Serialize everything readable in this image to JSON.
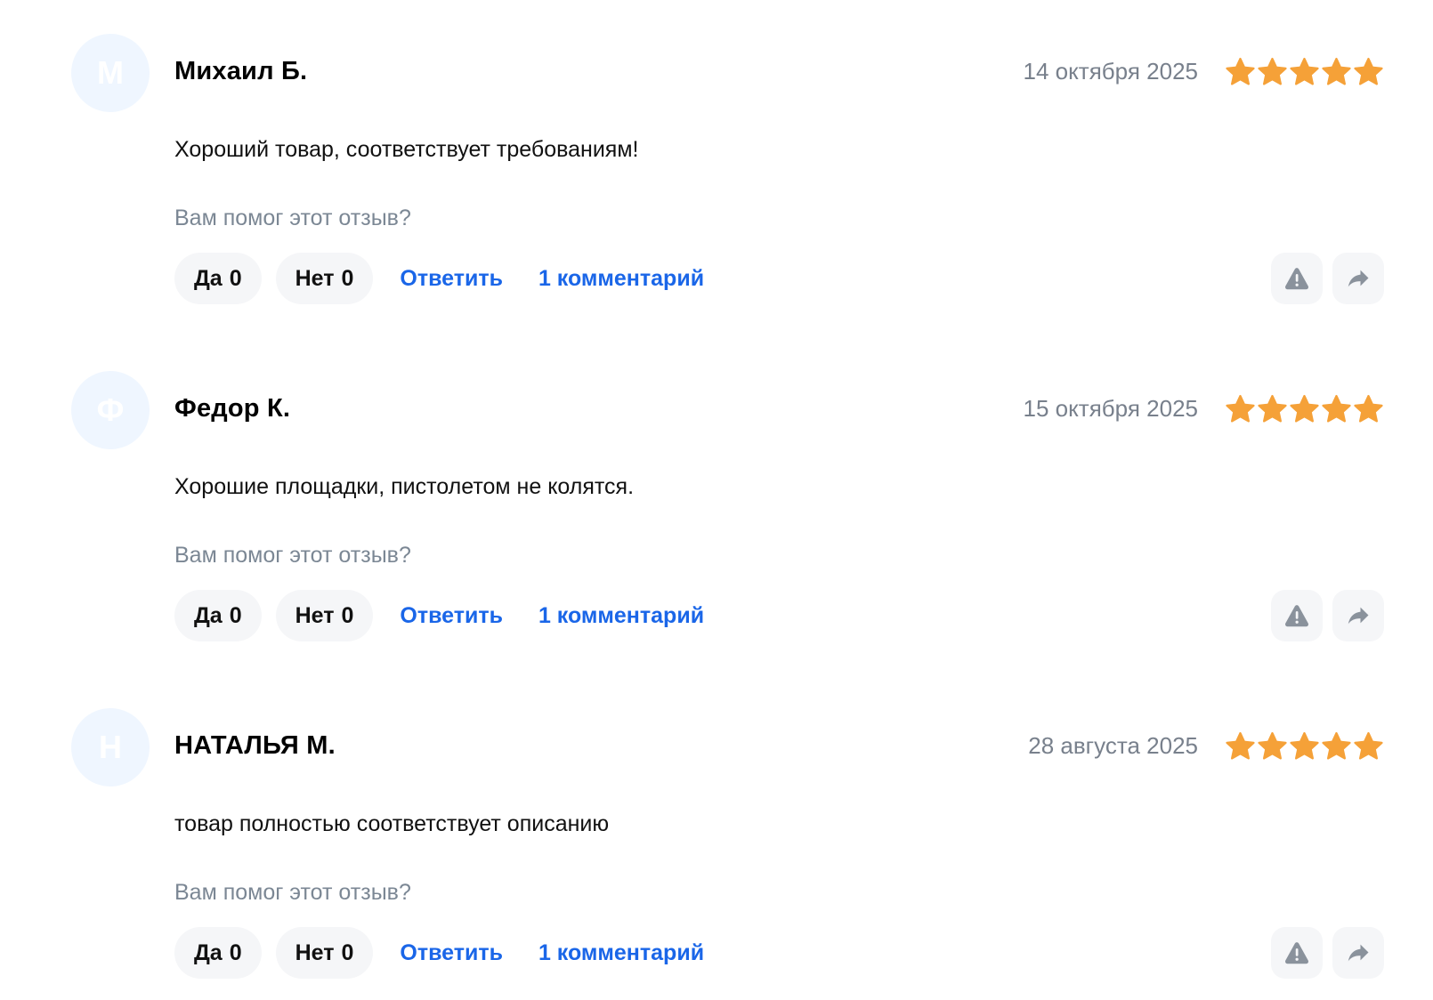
{
  "colors": {
    "star": "#f5a138",
    "link": "#1a66e8",
    "muted": "#7b8794",
    "avatar_bg": "#eff6ff",
    "button_bg": "#f5f6f8"
  },
  "icons": {
    "report": "warning-triangle-icon",
    "share": "share-arrow-icon",
    "star": "star-icon"
  },
  "reviews": [
    {
      "initial": "М",
      "author": "Михаил Б.",
      "date": "14 октября 2025",
      "rating": 5,
      "text": "Хороший товар, соответствует требованиям!",
      "helpful_question": "Вам помог этот отзыв?",
      "yes_label": "Да",
      "yes_count": "0",
      "no_label": "Нет",
      "no_count": "0",
      "reply_label": "Ответить",
      "comments_label": "1 комментарий"
    },
    {
      "initial": "Ф",
      "author": "Федор К.",
      "date": "15 октября 2025",
      "rating": 5,
      "text": "Хорошие площадки, пистолетом не колятся.",
      "helpful_question": "Вам помог этот отзыв?",
      "yes_label": "Да",
      "yes_count": "0",
      "no_label": "Нет",
      "no_count": "0",
      "reply_label": "Ответить",
      "comments_label": "1 комментарий"
    },
    {
      "initial": "Н",
      "author": "НАТАЛЬЯ М.",
      "date": "28 августа 2025",
      "rating": 5,
      "text": "товар полностью соответствует описанию",
      "helpful_question": "Вам помог этот отзыв?",
      "yes_label": "Да",
      "yes_count": "0",
      "no_label": "Нет",
      "no_count": "0",
      "reply_label": "Ответить",
      "comments_label": "1 комментарий"
    }
  ]
}
